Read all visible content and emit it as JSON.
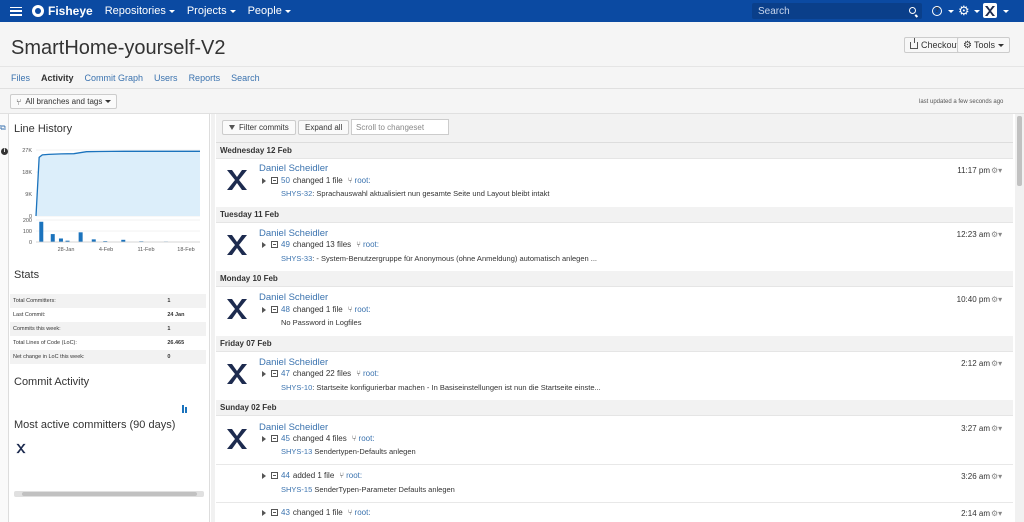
{
  "navbar": {
    "app_name": "Fisheye",
    "menu": [
      {
        "label": "Repositories"
      },
      {
        "label": "Projects"
      },
      {
        "label": "People"
      }
    ],
    "search_placeholder": "Search",
    "help_glyph": "?"
  },
  "header": {
    "title": "SmartHome-yourself-V2",
    "checkout_label": "Checkout",
    "tools_label": "Tools"
  },
  "tabs": [
    {
      "label": "Files"
    },
    {
      "label": "Activity",
      "active": true
    },
    {
      "label": "Commit Graph"
    },
    {
      "label": "Users"
    },
    {
      "label": "Reports"
    },
    {
      "label": "Search"
    }
  ],
  "branch_selector": {
    "label": "All branches and tags",
    "last_updated": "last updated a few seconds ago"
  },
  "sidebar": {
    "line_history_title": "Line History",
    "stats_title": "Stats",
    "commit_activity_title": "Commit Activity",
    "active_committers_title": "Most active committers (90 days)",
    "stats": [
      {
        "label": "Total Committers:",
        "value": "1"
      },
      {
        "label": "Last Commit:",
        "value": "24 Jan"
      },
      {
        "label": "Commits this week:",
        "value": "1"
      },
      {
        "label": "Total Lines of Code (LoC):",
        "value": "26.465"
      },
      {
        "label": "Net change in LoC this week:",
        "value": "0"
      }
    ]
  },
  "chart_data": {
    "type": "area",
    "title": "Line History",
    "line_chart": {
      "yticks": [
        "27K",
        "18K",
        "9K",
        "0"
      ],
      "ylim": [
        0,
        27000
      ],
      "x": [
        0,
        0.5,
        1,
        2,
        3,
        4,
        6,
        8,
        10,
        12,
        14,
        16,
        18,
        20,
        22,
        26
      ],
      "values": [
        0,
        24000,
        25000,
        25200,
        25300,
        25400,
        25500,
        26300,
        26400,
        26450,
        26465,
        26465,
        26465,
        26465,
        26465,
        26465
      ]
    },
    "bar_chart": {
      "yticks": [
        "200",
        "100",
        "0"
      ],
      "ylim": [
        0,
        250
      ],
      "values": [
        230,
        90,
        40,
        15,
        110,
        30,
        10,
        25,
        8,
        5
      ],
      "positions": [
        0.02,
        0.09,
        0.14,
        0.18,
        0.26,
        0.34,
        0.41,
        0.52,
        0.63,
        0.78
      ]
    },
    "xticks": [
      "28-Jan",
      "4-Feb",
      "11-Feb",
      "18-Feb"
    ]
  },
  "filterbar": {
    "filter_label": "Filter commits",
    "expand_label": "Expand all",
    "scroll_placeholder": "Scroll to changeset"
  },
  "days": [
    {
      "date": "Wednesday 12 Feb",
      "commits": [
        {
          "author": "Daniel Scheidler",
          "cs": "50",
          "change": "changed 1 file",
          "branch": "root:",
          "issue": "SHYS-32",
          "message": ": Sprachauswahl aktualisiert nun gesamte Seite und Layout bleibt intakt",
          "time": "11:17 pm"
        }
      ]
    },
    {
      "date": "Tuesday 11 Feb",
      "commits": [
        {
          "author": "Daniel Scheidler",
          "cs": "49",
          "change": "changed 13 files",
          "branch": "root:",
          "issue": "SHYS-33",
          "message": ": - System-Benutzergruppe für Anonymous (ohne Anmeldung) automatisch anlegen ...",
          "time": "12:23 am"
        }
      ]
    },
    {
      "date": "Monday 10 Feb",
      "commits": [
        {
          "author": "Daniel Scheidler",
          "cs": "48",
          "change": "changed 1 file",
          "branch": "root:",
          "issue": "",
          "message": "No Password in Logfiles",
          "time": "10:40 pm"
        }
      ]
    },
    {
      "date": "Friday 07 Feb",
      "commits": [
        {
          "author": "Daniel Scheidler",
          "cs": "47",
          "change": "changed 22 files",
          "branch": "root:",
          "issue": "SHYS-10",
          "message": ": Startseite konfigurierbar machen - In Basiseinstellungen ist nun die Startseite einste...",
          "time": "2:12 am"
        }
      ]
    },
    {
      "date": "Sunday 02 Feb",
      "commits": [
        {
          "author": "Daniel Scheidler",
          "cs": "45",
          "change": "changed 4 files",
          "branch": "root:",
          "issue": "SHYS-13",
          "message": " Sendertypen-Defaults anlegen",
          "time": "3:27 am"
        },
        {
          "author": "",
          "cs": "44",
          "change": "added 1 file",
          "branch": "root:",
          "issue": "SHYS-15",
          "message": " SenderTypen-Parameter Defaults anlegen",
          "time": "3:26 am"
        },
        {
          "author": "",
          "cs": "43",
          "change": "changed 1 file",
          "branch": "root:",
          "issue": "",
          "message": "",
          "time": "2:14 am"
        }
      ]
    }
  ]
}
